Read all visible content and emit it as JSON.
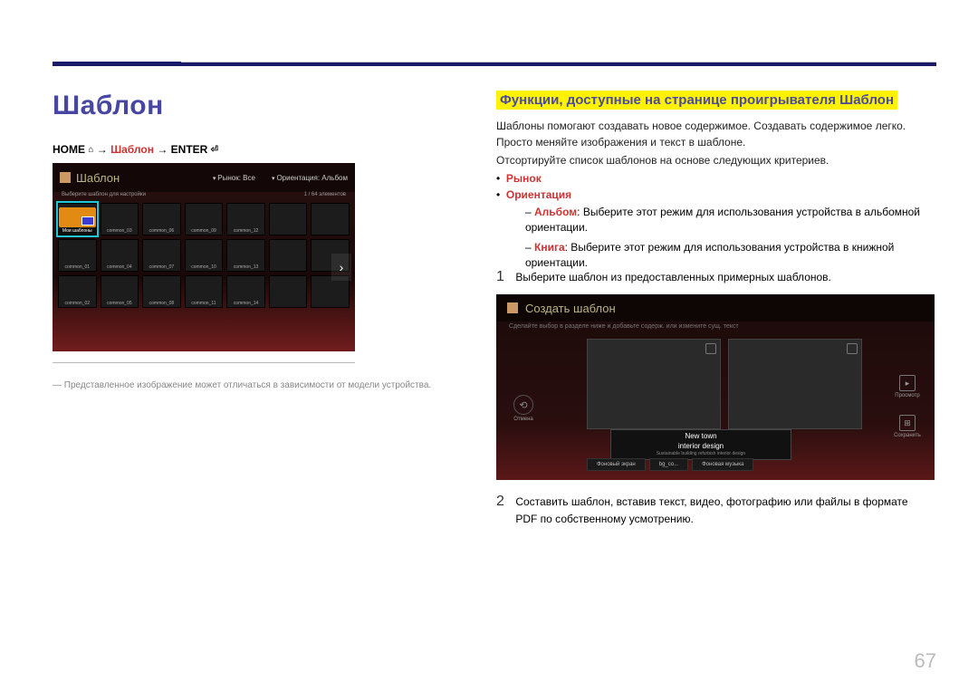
{
  "page": {
    "title": "Шаблон",
    "number": "67"
  },
  "breadcrumb": {
    "home": "HOME",
    "home_icon": "⌂",
    "arrow": "→",
    "template": "Шаблон",
    "enter": "ENTER",
    "enter_icon": "⏎"
  },
  "shot1": {
    "title": "Шаблон",
    "subtitle": "Выберите шаблон для настройки",
    "counter": "1 / 64 элементов",
    "filter_market": "Рынок: Все",
    "filter_orient": "Ориентация: Альбом",
    "selected_label": "Мои шаблоны",
    "arrow": "›",
    "cells": [
      "Мои шаблоны",
      "common_03",
      "common_06",
      "common_09",
      "common_12",
      "",
      "",
      "common_01",
      "common_04",
      "common_07",
      "common_10",
      "common_13",
      "",
      "",
      "common_02",
      "common_05",
      "common_08",
      "common_11",
      "common_14",
      "",
      ""
    ]
  },
  "footnote": "Представленное изображение может отличаться в зависимости от модели устройства.",
  "section_title": "Функции, доступные на странице проигрывателя Шаблон",
  "para1": "Шаблоны помогают создавать новое содержимое. Создавать содержимое легко. Просто меняйте изображения и текст в шаблоне.",
  "para2": "Отсортируйте список шаблонов на основе следующих критериев.",
  "bullets": {
    "b1": "Рынок",
    "b2": "Ориентация",
    "sub1_label": "Альбом",
    "sub1_text": ": Выберите этот режим для использования устройства в альбомной ориентации.",
    "sub2_label": "Книга",
    "sub2_text": ": Выберите этот режим для использования устройства в книжной ориентации."
  },
  "steps": {
    "s1": "Выберите шаблон из предоставленных примерных шаблонов.",
    "s2": "Составить шаблон, вставив текст, видео, фотографию или файлы в формате PDF по собственному усмотрению."
  },
  "shot2": {
    "title": "Создать шаблон",
    "subtitle": "Сделайте выбор в разделе ниже и добавьте содерж. или измените сущ. текст",
    "caption1": "New town",
    "caption2": "interior design",
    "caption3": "Sustainable building refurbish interior design",
    "cancel": "Отмена",
    "preview": "Просмотр",
    "save": "Сохранить",
    "tab1": "Фоновый экран",
    "tab2": "bg_co...",
    "tab3": "Фоновая музыка"
  }
}
